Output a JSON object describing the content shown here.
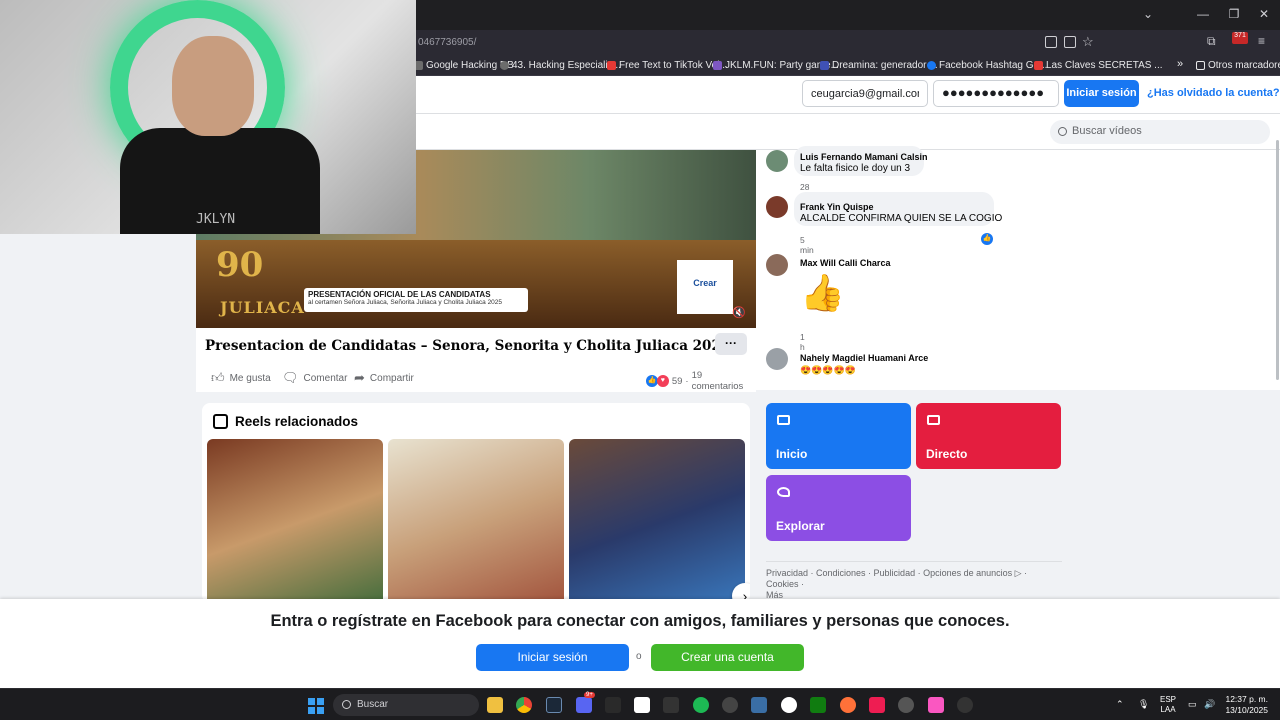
{
  "browser": {
    "url_fragment": "0467736905/",
    "bookmarks": [
      {
        "label": "Google Hacking DB",
        "color": "#6c6c6c"
      },
      {
        "label": "43. Hacking Especializ...",
        "color": "#6c6c6c"
      },
      {
        "label": "Free Text to TikTok Voi...",
        "color": "#e53935"
      },
      {
        "label": "JKLM.FUN: Party game...",
        "color": "#7e57c2"
      },
      {
        "label": "Dreamina: generador ...",
        "color": "#3f51b5"
      },
      {
        "label": "Facebook Hashtag Ge...",
        "color": "#1877f2"
      },
      {
        "label": "Las Claves SECRETAS ...",
        "color": "#e53935"
      }
    ],
    "other_bookmarks": "Otros marcadores",
    "extension_badge": "371"
  },
  "login": {
    "email_value": "ceugarcia9@gmail.com",
    "password_value": "●●●●●●●●●●●●●",
    "login_button": "Iniciar sesión",
    "forgot_link": "¿Has olvidado la cuenta?"
  },
  "video_search": {
    "placeholder": "Buscar vídeos"
  },
  "video": {
    "anniversary_number": "90",
    "anniversary_city": "JULIACA",
    "lower_third_title": "PRESENTACIÓN OFICIAL DE LAS CANDIDATAS",
    "lower_third_sub": "al certamen Señora Juliaca, Señorita Juliaca y Cholita Juliaca 2025",
    "channel_logo": "Crear",
    "webcam_watermark": "JKLYN",
    "title": "Presentacion de Candidatas – Senora, Senorita y Cholita Juliaca 2025",
    "more": "···",
    "actions": {
      "like": "Me gusta",
      "comment": "Comentar",
      "share": "Compartir"
    },
    "reaction_count": "59",
    "comment_count": "19 comentarios"
  },
  "comments": [
    {
      "author": "Luis Fernando Mamani Calsin",
      "text": "Le falta fisico le doy un 3",
      "time": "28 min"
    },
    {
      "author": "Frank Yin Quispe",
      "text": "ALCALDE CONFIRMA QUIEN SE LA COGIO",
      "time": "5 min"
    },
    {
      "author": "Max Will Calli Charca",
      "text": "👍",
      "time": "1 h"
    },
    {
      "author": "Nahely Magdiel Huamani Arce",
      "text": "😍😍😍😍😍",
      "time": ""
    }
  ],
  "reels": {
    "title": "Reels relacionados",
    "next": "›"
  },
  "nav_tiles": [
    {
      "label": "Inicio",
      "color": "#1877f2"
    },
    {
      "label": "Directo",
      "color": "#e41e3f"
    },
    {
      "label": "Explorar",
      "color": "#8c4ee4"
    }
  ],
  "footer": {
    "line1": "Privacidad · Condiciones · Publicidad · Opciones de anuncios ▷ · Cookies ·",
    "line2": "Más"
  },
  "banner": {
    "text": "Entra o regístrate en Facebook para conectar con amigos, familiares y personas que conoces.",
    "login": "Iniciar sesión",
    "or": "o",
    "create": "Crear una cuenta"
  },
  "taskbar": {
    "search": "Buscar",
    "lang_top": "ESP",
    "lang_bottom": "LAA",
    "time": "12:37 p. m.",
    "date": "13/10/2025",
    "badge": "9+"
  }
}
